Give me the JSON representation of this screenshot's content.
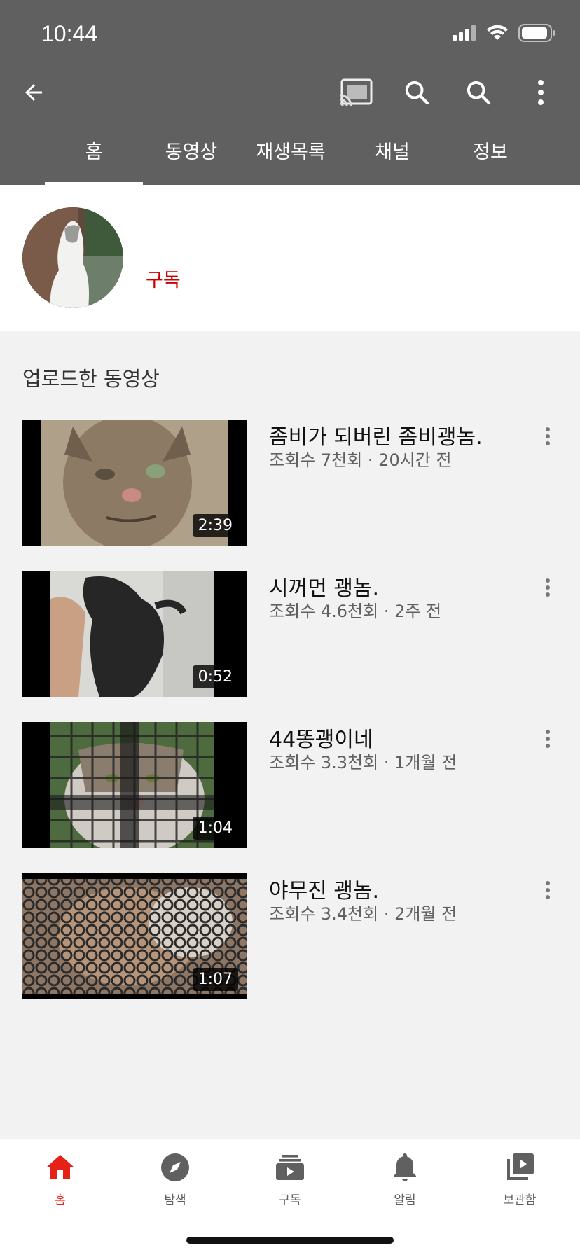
{
  "status_bar": {
    "time": "10:44"
  },
  "tabs": [
    {
      "label": "홈",
      "active": true
    },
    {
      "label": "동영상",
      "active": false
    },
    {
      "label": "재생목록",
      "active": false
    },
    {
      "label": "채널",
      "active": false
    },
    {
      "label": "정보",
      "active": false
    }
  ],
  "channel": {
    "subscribe_label": "구독"
  },
  "section": {
    "title": "업로드한 동영상"
  },
  "videos": [
    {
      "title": "좀비가 되버린 좀비괭놈.",
      "meta": "조회수 7천회 · 20시간 전",
      "duration": "2:39"
    },
    {
      "title": "시꺼먼 괭놈.",
      "meta": "조회수 4.6천회 · 2주 전",
      "duration": "0:52"
    },
    {
      "title": "44똥괭이네",
      "meta": "조회수 3.3천회 · 1개월 전",
      "duration": "1:04"
    },
    {
      "title": "야무진 괭놈.",
      "meta": "조회수 3.4천회 · 2개월 전",
      "duration": "1:07"
    }
  ],
  "bottom_nav": [
    {
      "label": "홈",
      "icon": "home-icon",
      "active": true
    },
    {
      "label": "탐색",
      "icon": "compass-icon",
      "active": false
    },
    {
      "label": "구독",
      "icon": "subscriptions-icon",
      "active": false
    },
    {
      "label": "알림",
      "icon": "bell-icon",
      "active": false
    },
    {
      "label": "보관함",
      "icon": "library-icon",
      "active": false
    }
  ],
  "colors": {
    "header": "#606060",
    "accent": "#e62117",
    "subscribe": "#cc0000"
  }
}
